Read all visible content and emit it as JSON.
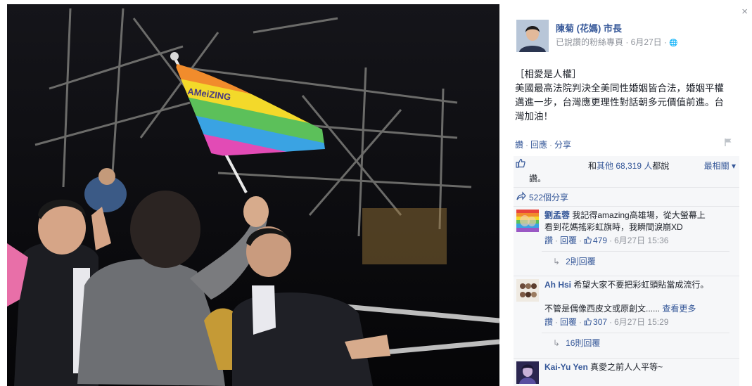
{
  "photo": {
    "flag_brand": "AMeiZING",
    "rainbow_colors": [
      "#e9443b",
      "#f18c2c",
      "#f3d92a",
      "#5cc05a",
      "#3aa3e3",
      "#e24bb5"
    ]
  },
  "close_label": "×",
  "post": {
    "page_name": "陳菊 (花媽) 市長",
    "meta": "已說讚的粉絲專頁 · 6月27日 · ",
    "globe": "🌐",
    "text_lines": [
      "［相愛是人權］",
      "美國最高法院判決全美同性婚姻皆合法，婚姻平權",
      "邁進一步，台灣應更理性對話朝多元價值前進。台",
      "灣加油！"
    ],
    "actions": {
      "like": "讚",
      "reply": "回應",
      "share": "分享"
    }
  },
  "feedback": {
    "likes_prefix": "和",
    "likes_count": "其他 68,319 人",
    "likes_suffix": "都說",
    "likes_tail": "讚。",
    "sort_label": "最相關 ▾",
    "shares": "522個分享"
  },
  "comments": [
    {
      "author": "劉孟蓉",
      "lines": [
        "我記得amazing高雄場，從大螢幕上",
        "看到花媽搖彩虹旗時，我瞬間淚崩XD"
      ],
      "like": "讚",
      "reply": "回覆",
      "likes": "479",
      "time": "6月27日 15:36",
      "replies": "2則回覆"
    },
    {
      "author": "Ah Hsi",
      "lines": [
        "希望大家不要把彩虹頭貼當成流行。",
        "",
        "不管是偶像西皮文或原創文...... "
      ],
      "see_more": "查看更多",
      "like": "讚",
      "reply": "回覆",
      "likes": "307",
      "time": "6月27日 15:29",
      "replies": "16則回覆"
    },
    {
      "author": "Kai-Yu Yen",
      "lines": [
        "真愛之前人人平等~"
      ]
    }
  ]
}
